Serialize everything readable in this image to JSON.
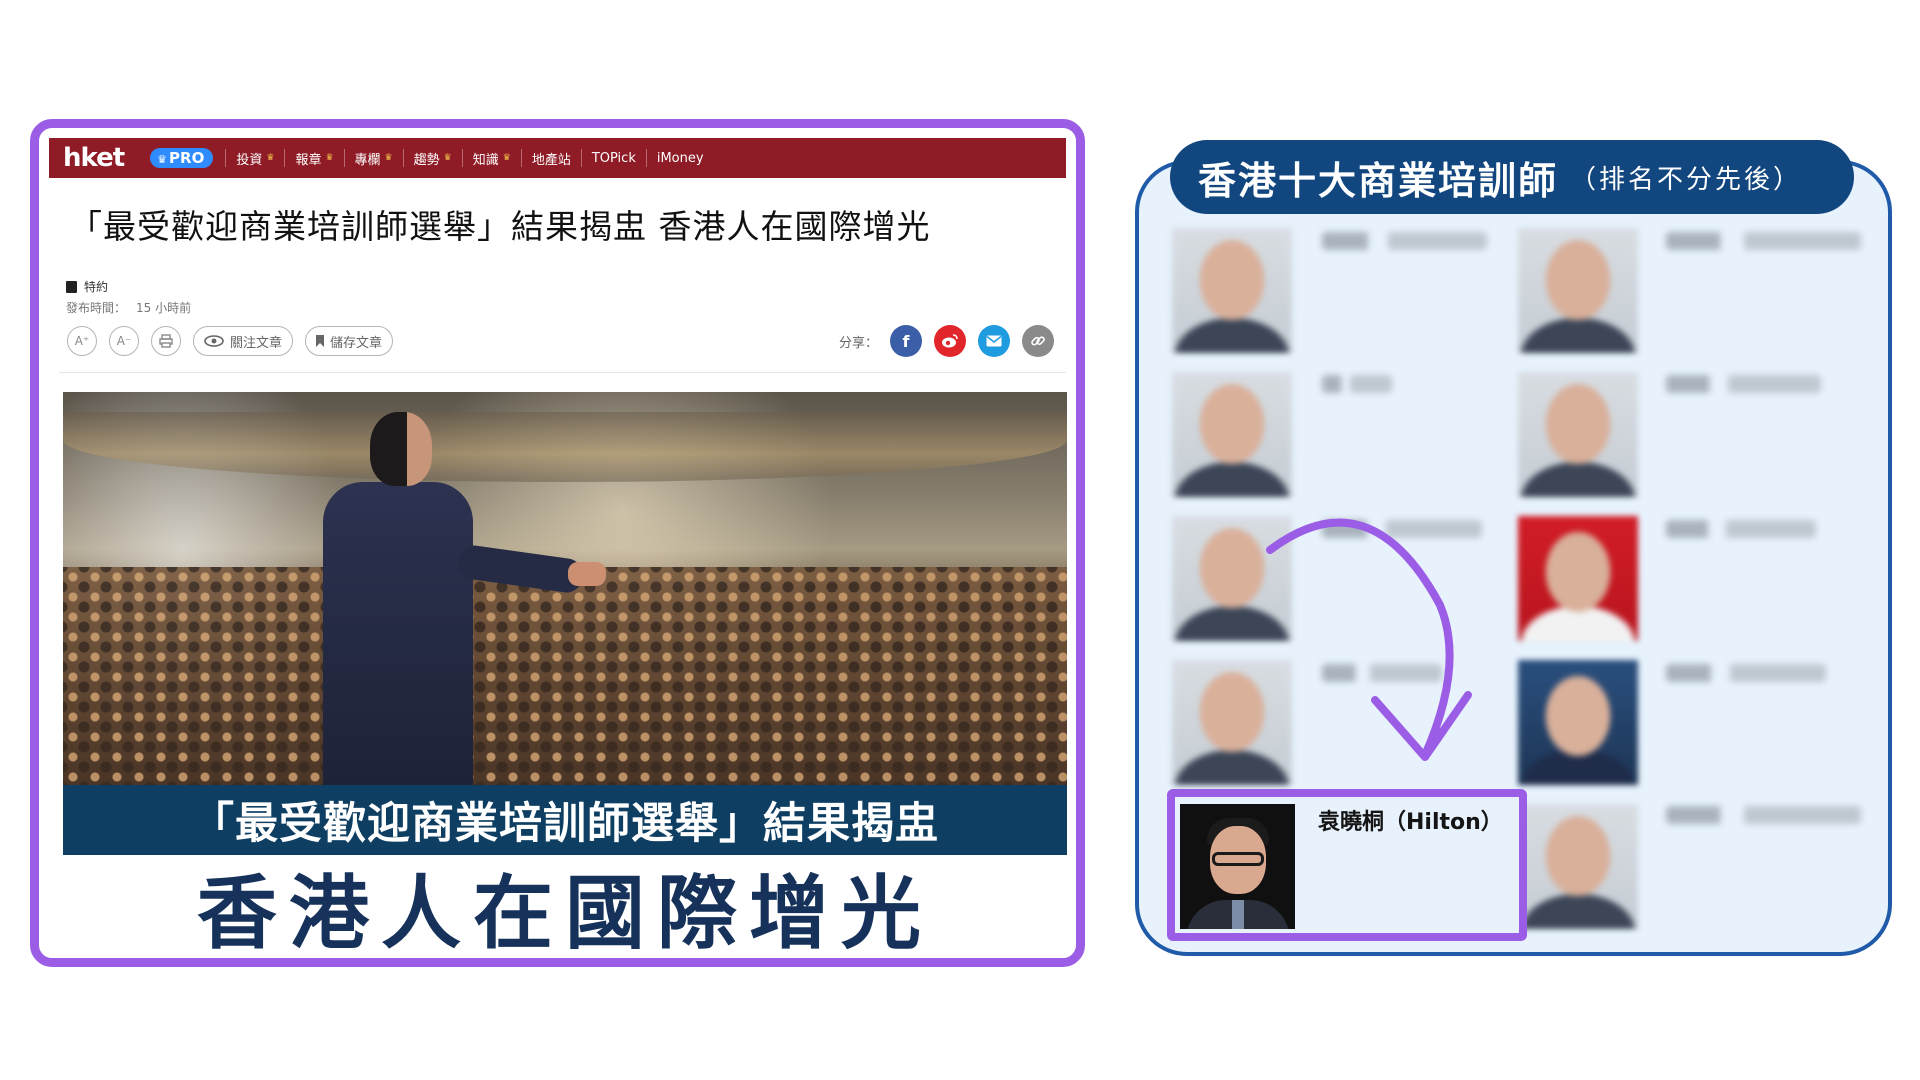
{
  "article": {
    "logo": "hket",
    "pro_badge": "PRO",
    "nav": [
      {
        "label": "投資",
        "premium": true
      },
      {
        "label": "報章",
        "premium": true
      },
      {
        "label": "專欄",
        "premium": true
      },
      {
        "label": "趨勢",
        "premium": true
      },
      {
        "label": "知識",
        "premium": true
      },
      {
        "label": "地產站",
        "premium": false
      },
      {
        "label": "TOPick",
        "premium": false
      },
      {
        "label": "iMoney",
        "premium": false
      }
    ],
    "headline": "「最受歡迎商業培訓師選舉」結果揭盅 香港人在國際增光",
    "category": "特約",
    "published_label": "發布時間：",
    "published_value": "15 小時前",
    "toolbar": {
      "font_increase": "A⁺",
      "font_decrease": "A⁻",
      "print_icon": "print-icon",
      "follow": "關注文章",
      "save": "儲存文章",
      "share_label": "分享："
    },
    "share_colors": {
      "facebook": "#3b5ea8",
      "weibo": "#e0262b",
      "email": "#1f9be0",
      "link": "#8a8a8a"
    },
    "hero_line1": "「最受歡迎商業培訓師選舉」結果揭盅",
    "hero_line2": "香港人在國際增光"
  },
  "ranking": {
    "title": "香港十大商業培訓師",
    "subtitle": "（排名不分先後）",
    "featured_name": "袁曉桐（Hilton）"
  },
  "colors": {
    "highlight": "#9b5de5",
    "nav_bar": "#8e1b25",
    "card_border": "#1f5ba8",
    "title_pill": "#11467f"
  }
}
